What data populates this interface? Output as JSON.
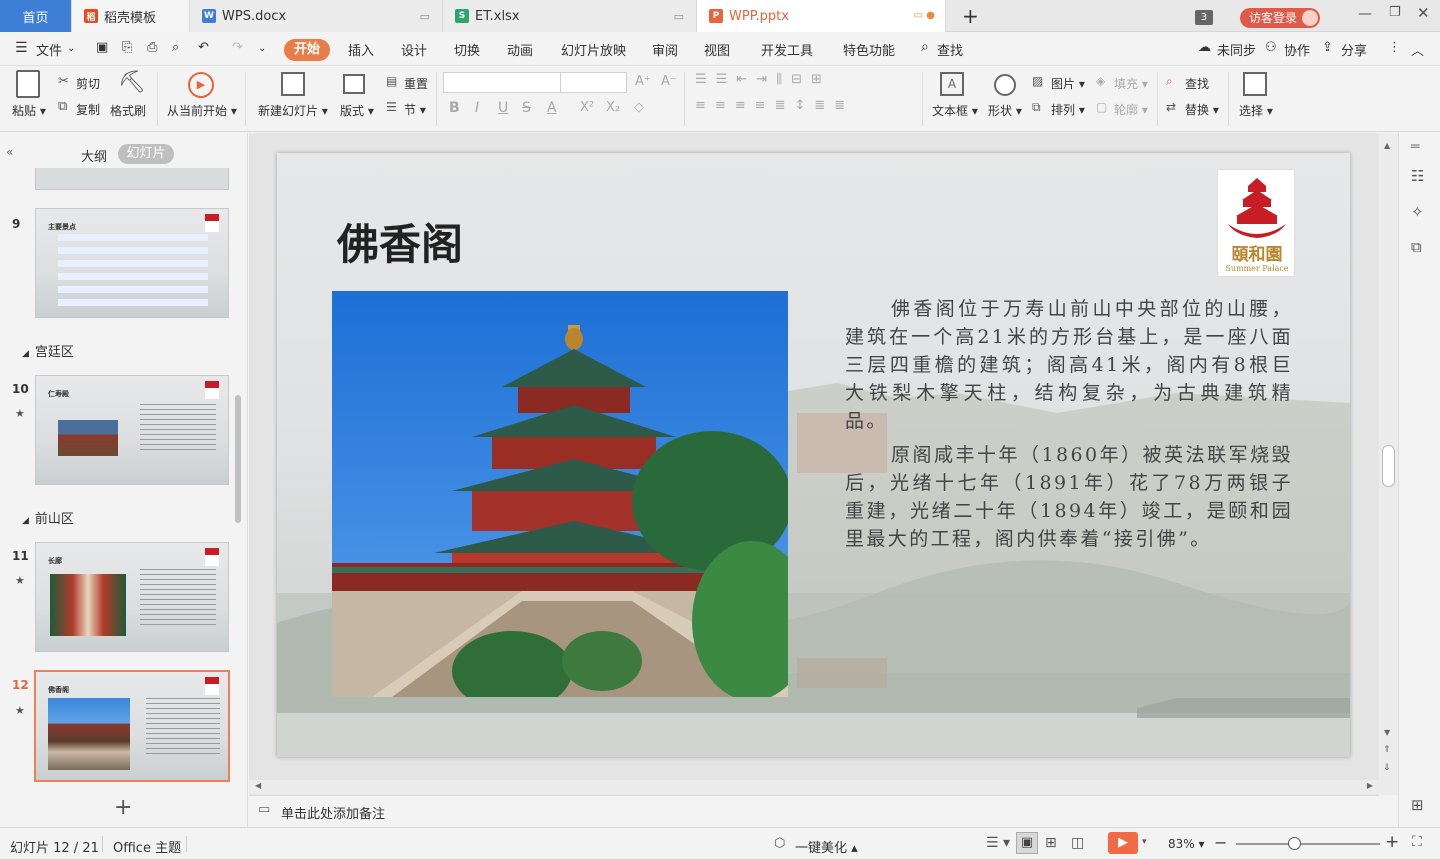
{
  "tabs": [
    {
      "label": "首页",
      "active": true
    },
    {
      "label": "稻壳模板"
    },
    {
      "label": "WPS.docx"
    },
    {
      "label": "ET.xlsx"
    },
    {
      "label": "WPP.pptx"
    }
  ],
  "tabbar": {
    "badge": "3",
    "visitor": "访客登录"
  },
  "menu": {
    "file": "文件",
    "items": [
      "开始",
      "插入",
      "设计",
      "切换",
      "动画",
      "幻灯片放映",
      "审阅",
      "视图",
      "开发工具",
      "特色功能"
    ],
    "search": "查找",
    "unsync": "未同步",
    "collab": "协作",
    "share": "分享"
  },
  "ribbon": {
    "paste": "粘贴",
    "cut": "剪切",
    "copy": "复制",
    "format_painter": "格式刷",
    "from_current": "从当前开始",
    "new_slide": "新建幻灯片",
    "layout": "版式",
    "reset": "重置",
    "section": "节",
    "textbox": "文本框",
    "shape": "形状",
    "picture": "图片",
    "fill": "填充",
    "arrange": "排列",
    "outline": "轮廓",
    "find": "查找",
    "replace": "替换",
    "select": "选择"
  },
  "panel": {
    "outline_tab": "大纲",
    "slides_tab": "幻灯片",
    "sections": [
      "宫廷区",
      "前山区"
    ],
    "thumbs": [
      {
        "num": "9",
        "title": "主要景点"
      },
      {
        "num": "10",
        "title": "仁寿殿"
      },
      {
        "num": "11",
        "title": "长廊"
      },
      {
        "num": "12",
        "title": "佛香阁"
      }
    ]
  },
  "slide": {
    "title": "佛香阁",
    "logo_text": "頤和園",
    "logo_sub": "Summer Palace",
    "p1": "佛香阁位于万寿山前山中央部位的山腰，建筑在一个高21米的方形台基上，是一座八面三层四重檐的建筑；阁高41米，阁内有8根巨大铁梨木擎天柱，结构复杂，为古典建筑精品。",
    "p2": "原阁咸丰十年（1860年）被英法联军烧毁后，光绪十七年（1891年）花了78万两银子重建，光绪二十年（1894年）竣工，是颐和园里最大的工程，阁内供奉着“接引佛”。"
  },
  "notes": {
    "placeholder": "单击此处添加备注"
  },
  "status": {
    "slide_info": "幻灯片 12 / 21",
    "theme": "Office 主题",
    "beautify": "一键美化",
    "zoom": "83%"
  }
}
